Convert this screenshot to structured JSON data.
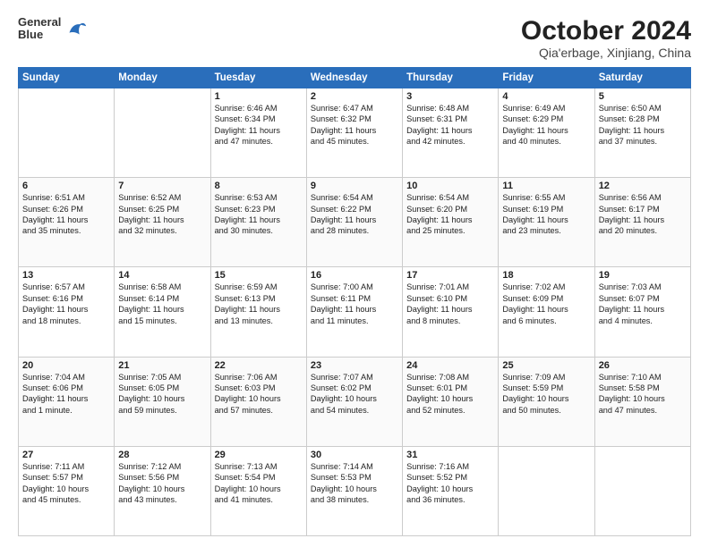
{
  "header": {
    "logo_line1": "General",
    "logo_line2": "Blue",
    "month": "October 2024",
    "location": "Qia'erbage, Xinjiang, China"
  },
  "weekdays": [
    "Sunday",
    "Monday",
    "Tuesday",
    "Wednesday",
    "Thursday",
    "Friday",
    "Saturday"
  ],
  "weeks": [
    [
      {
        "day": "",
        "detail": ""
      },
      {
        "day": "",
        "detail": ""
      },
      {
        "day": "1",
        "detail": "Sunrise: 6:46 AM\nSunset: 6:34 PM\nDaylight: 11 hours\nand 47 minutes."
      },
      {
        "day": "2",
        "detail": "Sunrise: 6:47 AM\nSunset: 6:32 PM\nDaylight: 11 hours\nand 45 minutes."
      },
      {
        "day": "3",
        "detail": "Sunrise: 6:48 AM\nSunset: 6:31 PM\nDaylight: 11 hours\nand 42 minutes."
      },
      {
        "day": "4",
        "detail": "Sunrise: 6:49 AM\nSunset: 6:29 PM\nDaylight: 11 hours\nand 40 minutes."
      },
      {
        "day": "5",
        "detail": "Sunrise: 6:50 AM\nSunset: 6:28 PM\nDaylight: 11 hours\nand 37 minutes."
      }
    ],
    [
      {
        "day": "6",
        "detail": "Sunrise: 6:51 AM\nSunset: 6:26 PM\nDaylight: 11 hours\nand 35 minutes."
      },
      {
        "day": "7",
        "detail": "Sunrise: 6:52 AM\nSunset: 6:25 PM\nDaylight: 11 hours\nand 32 minutes."
      },
      {
        "day": "8",
        "detail": "Sunrise: 6:53 AM\nSunset: 6:23 PM\nDaylight: 11 hours\nand 30 minutes."
      },
      {
        "day": "9",
        "detail": "Sunrise: 6:54 AM\nSunset: 6:22 PM\nDaylight: 11 hours\nand 28 minutes."
      },
      {
        "day": "10",
        "detail": "Sunrise: 6:54 AM\nSunset: 6:20 PM\nDaylight: 11 hours\nand 25 minutes."
      },
      {
        "day": "11",
        "detail": "Sunrise: 6:55 AM\nSunset: 6:19 PM\nDaylight: 11 hours\nand 23 minutes."
      },
      {
        "day": "12",
        "detail": "Sunrise: 6:56 AM\nSunset: 6:17 PM\nDaylight: 11 hours\nand 20 minutes."
      }
    ],
    [
      {
        "day": "13",
        "detail": "Sunrise: 6:57 AM\nSunset: 6:16 PM\nDaylight: 11 hours\nand 18 minutes."
      },
      {
        "day": "14",
        "detail": "Sunrise: 6:58 AM\nSunset: 6:14 PM\nDaylight: 11 hours\nand 15 minutes."
      },
      {
        "day": "15",
        "detail": "Sunrise: 6:59 AM\nSunset: 6:13 PM\nDaylight: 11 hours\nand 13 minutes."
      },
      {
        "day": "16",
        "detail": "Sunrise: 7:00 AM\nSunset: 6:11 PM\nDaylight: 11 hours\nand 11 minutes."
      },
      {
        "day": "17",
        "detail": "Sunrise: 7:01 AM\nSunset: 6:10 PM\nDaylight: 11 hours\nand 8 minutes."
      },
      {
        "day": "18",
        "detail": "Sunrise: 7:02 AM\nSunset: 6:09 PM\nDaylight: 11 hours\nand 6 minutes."
      },
      {
        "day": "19",
        "detail": "Sunrise: 7:03 AM\nSunset: 6:07 PM\nDaylight: 11 hours\nand 4 minutes."
      }
    ],
    [
      {
        "day": "20",
        "detail": "Sunrise: 7:04 AM\nSunset: 6:06 PM\nDaylight: 11 hours\nand 1 minute."
      },
      {
        "day": "21",
        "detail": "Sunrise: 7:05 AM\nSunset: 6:05 PM\nDaylight: 10 hours\nand 59 minutes."
      },
      {
        "day": "22",
        "detail": "Sunrise: 7:06 AM\nSunset: 6:03 PM\nDaylight: 10 hours\nand 57 minutes."
      },
      {
        "day": "23",
        "detail": "Sunrise: 7:07 AM\nSunset: 6:02 PM\nDaylight: 10 hours\nand 54 minutes."
      },
      {
        "day": "24",
        "detail": "Sunrise: 7:08 AM\nSunset: 6:01 PM\nDaylight: 10 hours\nand 52 minutes."
      },
      {
        "day": "25",
        "detail": "Sunrise: 7:09 AM\nSunset: 5:59 PM\nDaylight: 10 hours\nand 50 minutes."
      },
      {
        "day": "26",
        "detail": "Sunrise: 7:10 AM\nSunset: 5:58 PM\nDaylight: 10 hours\nand 47 minutes."
      }
    ],
    [
      {
        "day": "27",
        "detail": "Sunrise: 7:11 AM\nSunset: 5:57 PM\nDaylight: 10 hours\nand 45 minutes."
      },
      {
        "day": "28",
        "detail": "Sunrise: 7:12 AM\nSunset: 5:56 PM\nDaylight: 10 hours\nand 43 minutes."
      },
      {
        "day": "29",
        "detail": "Sunrise: 7:13 AM\nSunset: 5:54 PM\nDaylight: 10 hours\nand 41 minutes."
      },
      {
        "day": "30",
        "detail": "Sunrise: 7:14 AM\nSunset: 5:53 PM\nDaylight: 10 hours\nand 38 minutes."
      },
      {
        "day": "31",
        "detail": "Sunrise: 7:16 AM\nSunset: 5:52 PM\nDaylight: 10 hours\nand 36 minutes."
      },
      {
        "day": "",
        "detail": ""
      },
      {
        "day": "",
        "detail": ""
      }
    ]
  ]
}
